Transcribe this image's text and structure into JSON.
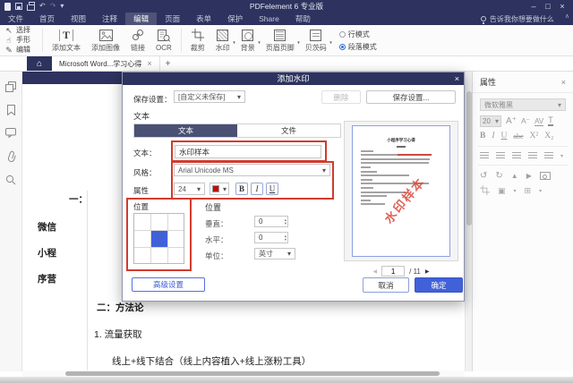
{
  "titlebar": {
    "app_title": "PDFelement 6 专业版",
    "minimize": "–",
    "maximize": "□",
    "close": "×"
  },
  "menubar": {
    "items": [
      "文件",
      "首页",
      "视图",
      "注释",
      "编辑",
      "页面",
      "表单",
      "保护",
      "Share",
      "帮助"
    ],
    "tell_me": "告诉我你想要做什么"
  },
  "toolbar": {
    "select": "选择",
    "hand": "手形",
    "edit": "编辑",
    "add_text": "添加文本",
    "add_image": "添加图像",
    "link": "链接",
    "ocr": "OCR",
    "crop": "裁剪",
    "watermark": "水印",
    "background": "背景",
    "header_footer": "页眉页脚",
    "bates": "贝茨码",
    "line_mode": "行模式",
    "paragraph_mode": "段落模式"
  },
  "tabbar": {
    "document_tab": "Microsoft Word...学习心得",
    "close_tab": "×",
    "new_tab": "+"
  },
  "document": {
    "lines": [
      "一：",
      "微信",
      "小程",
      "序营",
      "二：方法论",
      "1. 流量获取",
      "线上+线下结合（线上内容植入+线上涨粉工具）"
    ]
  },
  "dialog": {
    "title": "添加水印",
    "save_settings_label": "保存设置：",
    "save_settings_value": "[自定义未保存]",
    "delete_button": "删除",
    "save_settings_button": "保存设置...",
    "text_section_label": "文本",
    "tab_text": "文本",
    "tab_file": "文件",
    "text_label": "文本：",
    "text_value": "水印样本",
    "style_label": "风格：",
    "style_value": "Arial Unicode MS",
    "attributes_label": "属性",
    "font_size": "24",
    "bold": "B",
    "italic": "I",
    "underline": "U",
    "grid_label": "位置",
    "position_label": "位置",
    "vertical_label": "垂直：",
    "vertical_value": "0",
    "horizontal_label": "水平：",
    "horizontal_value": "0",
    "unit_label": "单位：",
    "unit_value": "英寸",
    "advanced_button": "高级设置",
    "cancel_button": "取消",
    "ok_button": "确定",
    "preview": {
      "page_title": "小程序学习心得",
      "watermark_text": "水印样本",
      "current_page": "1",
      "total_pages": "/ 11",
      "bars": [
        {
          "w": 12,
          "center": true
        },
        {
          "w": 16
        },
        {
          "w": 88,
          "red": true
        },
        {
          "w": 86
        },
        {
          "w": 84
        },
        {
          "w": 12
        },
        {
          "w": 20
        },
        {
          "w": 60
        },
        {
          "w": 14
        },
        {
          "w": 84
        },
        {
          "w": 16
        },
        {
          "w": 56
        },
        {
          "w": 32
        },
        {
          "w": 12
        },
        {
          "w": 30
        }
      ]
    }
  },
  "properties_panel": {
    "title": "属性",
    "font_name": "微软雅黑",
    "font_size": "20",
    "font_up": "A⁺",
    "font_down": "A⁻",
    "kerning": "AV",
    "color_tool": "T",
    "bold": "B",
    "italic": "I",
    "underline": "U",
    "strike": "abc",
    "superscript": "X²",
    "subscript": "X₂"
  },
  "icons": {
    "home": "⌂",
    "undo": "↶",
    "redo": "↷",
    "dropdown": "▾",
    "hand": "☝",
    "pencil": "✎",
    "cursor": "↖",
    "prev": "◀",
    "next": "▶",
    "chevron_up": "∧",
    "rotate_left": "↺",
    "rotate_right": "↻",
    "flip_v": "▲",
    "flip_h": "▶",
    "layers": "▣",
    "group": "⊞",
    "up": "▴",
    "down": "▾"
  },
  "colors": {
    "navy": "#2d335e",
    "accent": "#4161d8",
    "annotation": "#d23b2d",
    "watermark": "#d6483c",
    "swatch": "#c00b0b"
  }
}
